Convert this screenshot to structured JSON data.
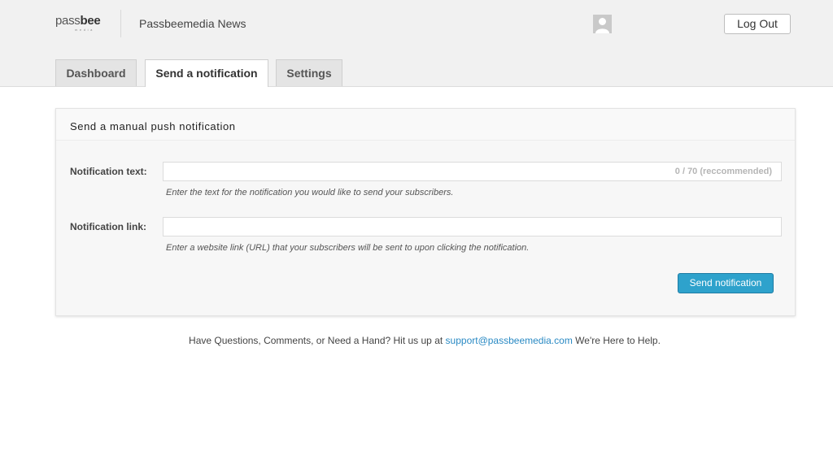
{
  "header": {
    "logo_main": "pass",
    "logo_bold": "bee",
    "logo_sub": "media",
    "site_name": "Passbeemedia News",
    "logout_label": "Log Out"
  },
  "tabs": [
    {
      "label": "Dashboard",
      "active": false
    },
    {
      "label": "Send a notification",
      "active": true
    },
    {
      "label": "Settings",
      "active": false
    }
  ],
  "panel": {
    "title": "Send a manual push notification",
    "text_field": {
      "label": "Notification text:",
      "value": "",
      "counter": "0 / 70 (reccommended)",
      "hint": "Enter the text for the notification you would like to send your subscribers."
    },
    "link_field": {
      "label": "Notification link:",
      "value": "",
      "hint": "Enter a website link (URL) that your subscribers will be sent to upon clicking the notification."
    },
    "submit_label": "Send notification"
  },
  "footer": {
    "prefix": "Have Questions, Comments, or Need a Hand? Hit us up at",
    "email": "support@passbeemedia.com",
    "suffix": "We're Here to Help."
  },
  "colors": {
    "accent": "#2ea2cc",
    "link": "#2a8ac4",
    "header_bg": "#f1f1f1"
  },
  "icons": {
    "avatar": "user-avatar-icon"
  }
}
